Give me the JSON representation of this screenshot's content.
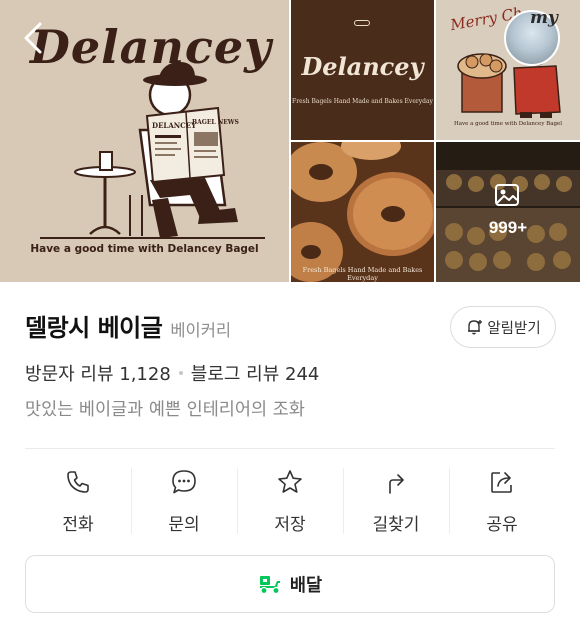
{
  "gallery": {
    "main_logo": "Delancey",
    "main_tagline": "Have a good time with Delancey Bagel",
    "tile1_logo": "Delancey",
    "tile1_tagline": "Fresh Bagels Hand Made and Bakes Everyday",
    "tile2_heading": "Merry Ch",
    "tile2_tagline": "Have a good time with Delancey Bagel",
    "tile3_tagline": "Fresh Bagels Hand Made and Bakes Everyday",
    "my_badge": "my",
    "more_count": "999+"
  },
  "place": {
    "name": "델랑시 베이글",
    "category": "베이커리",
    "alarm_label": "알림받기",
    "visitor_review": "방문자 리뷰 1,128",
    "blog_review": "블로그 리뷰 244",
    "description": "맛있는 베이글과 예쁜 인테리어의 조화"
  },
  "actions": [
    {
      "label": "전화",
      "icon": "phone-icon"
    },
    {
      "label": "문의",
      "icon": "chat-icon"
    },
    {
      "label": "저장",
      "icon": "star-icon"
    },
    {
      "label": "길찾기",
      "icon": "directions-icon"
    },
    {
      "label": "공유",
      "icon": "share-icon"
    }
  ],
  "delivery": {
    "label": "배달",
    "icon": "delivery-scooter-icon",
    "icon_color": "#03c75a"
  }
}
